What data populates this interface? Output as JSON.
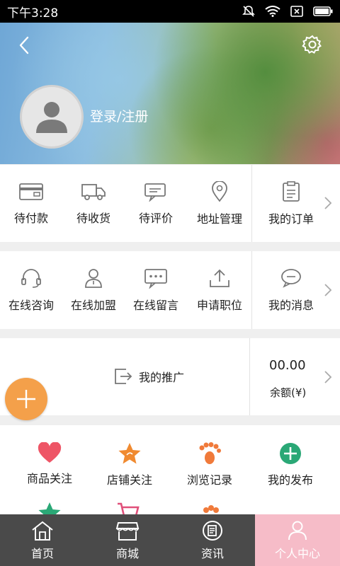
{
  "status_bar": {
    "time": "下午3:28"
  },
  "profile": {
    "login_label": "登录/注册"
  },
  "order_row": {
    "items": [
      {
        "label": "待付款",
        "icon": "wallet-icon"
      },
      {
        "label": "待收货",
        "icon": "truck-icon"
      },
      {
        "label": "待评价",
        "icon": "comment-icon"
      },
      {
        "label": "地址管理",
        "icon": "location-pin-icon"
      }
    ],
    "side": {
      "label": "我的订单",
      "icon": "order-list-icon"
    }
  },
  "service_row": {
    "items": [
      {
        "label": "在线咨询",
        "icon": "headset-icon"
      },
      {
        "label": "在线加盟",
        "icon": "person-icon"
      },
      {
        "label": "在线留言",
        "icon": "chat-dots-icon"
      },
      {
        "label": "申请职位",
        "icon": "upload-icon"
      }
    ],
    "side": {
      "label": "我的消息",
      "icon": "message-icon"
    }
  },
  "promo": {
    "label": "我的推广",
    "balance_value": "00.00",
    "balance_label": "余额(¥)"
  },
  "quick_grid": [
    {
      "label": "商品关注",
      "icon": "heart-icon",
      "color": "#ee5566"
    },
    {
      "label": "店铺关注",
      "icon": "star-icon",
      "color": "#f08a30"
    },
    {
      "label": "浏览记录",
      "icon": "footprint-icon",
      "color": "#f07a3a"
    },
    {
      "label": "我的发布",
      "icon": "plus-circle-icon",
      "color": "#2aa876"
    }
  ],
  "tabbar": [
    {
      "label": "首页",
      "icon": "home-icon"
    },
    {
      "label": "商城",
      "icon": "store-icon"
    },
    {
      "label": "资讯",
      "icon": "news-icon"
    },
    {
      "label": "个人中心",
      "icon": "user-icon",
      "active": true
    }
  ],
  "colors": {
    "fab": "#f4a04a",
    "tab_active": "#f6bcc8",
    "tabbar": "#4a4a4a"
  }
}
